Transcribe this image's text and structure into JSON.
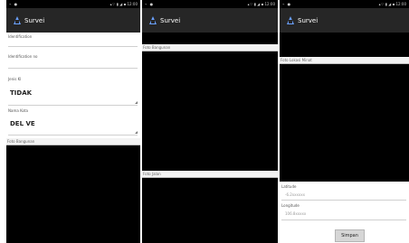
{
  "status": {
    "left": "⌁ ●",
    "right": "▴⌔ ▮ ◢ ▪ 12:00"
  },
  "app": {
    "title": "Survei"
  },
  "screen1": {
    "field1_label": "Identification",
    "field2_label": "Identification no",
    "field3_label": "Jenis Kl",
    "field3_value": "TIDAK",
    "field4_label": "Nama Kota",
    "field4_value": "DEL VE",
    "section_label": "Foto Bangunan"
  },
  "screen2": {
    "section1_label": "Foto Bangunan",
    "section2_label": "Foto Jalan"
  },
  "screen3": {
    "section_label": "Foto Lokasi Minat",
    "lat_label": "Latitude",
    "lat_value": "-6.2xxxxxx",
    "lng_label": "Longitude",
    "lng_value": "106.8xxxxx",
    "button_label": "Simpan"
  }
}
